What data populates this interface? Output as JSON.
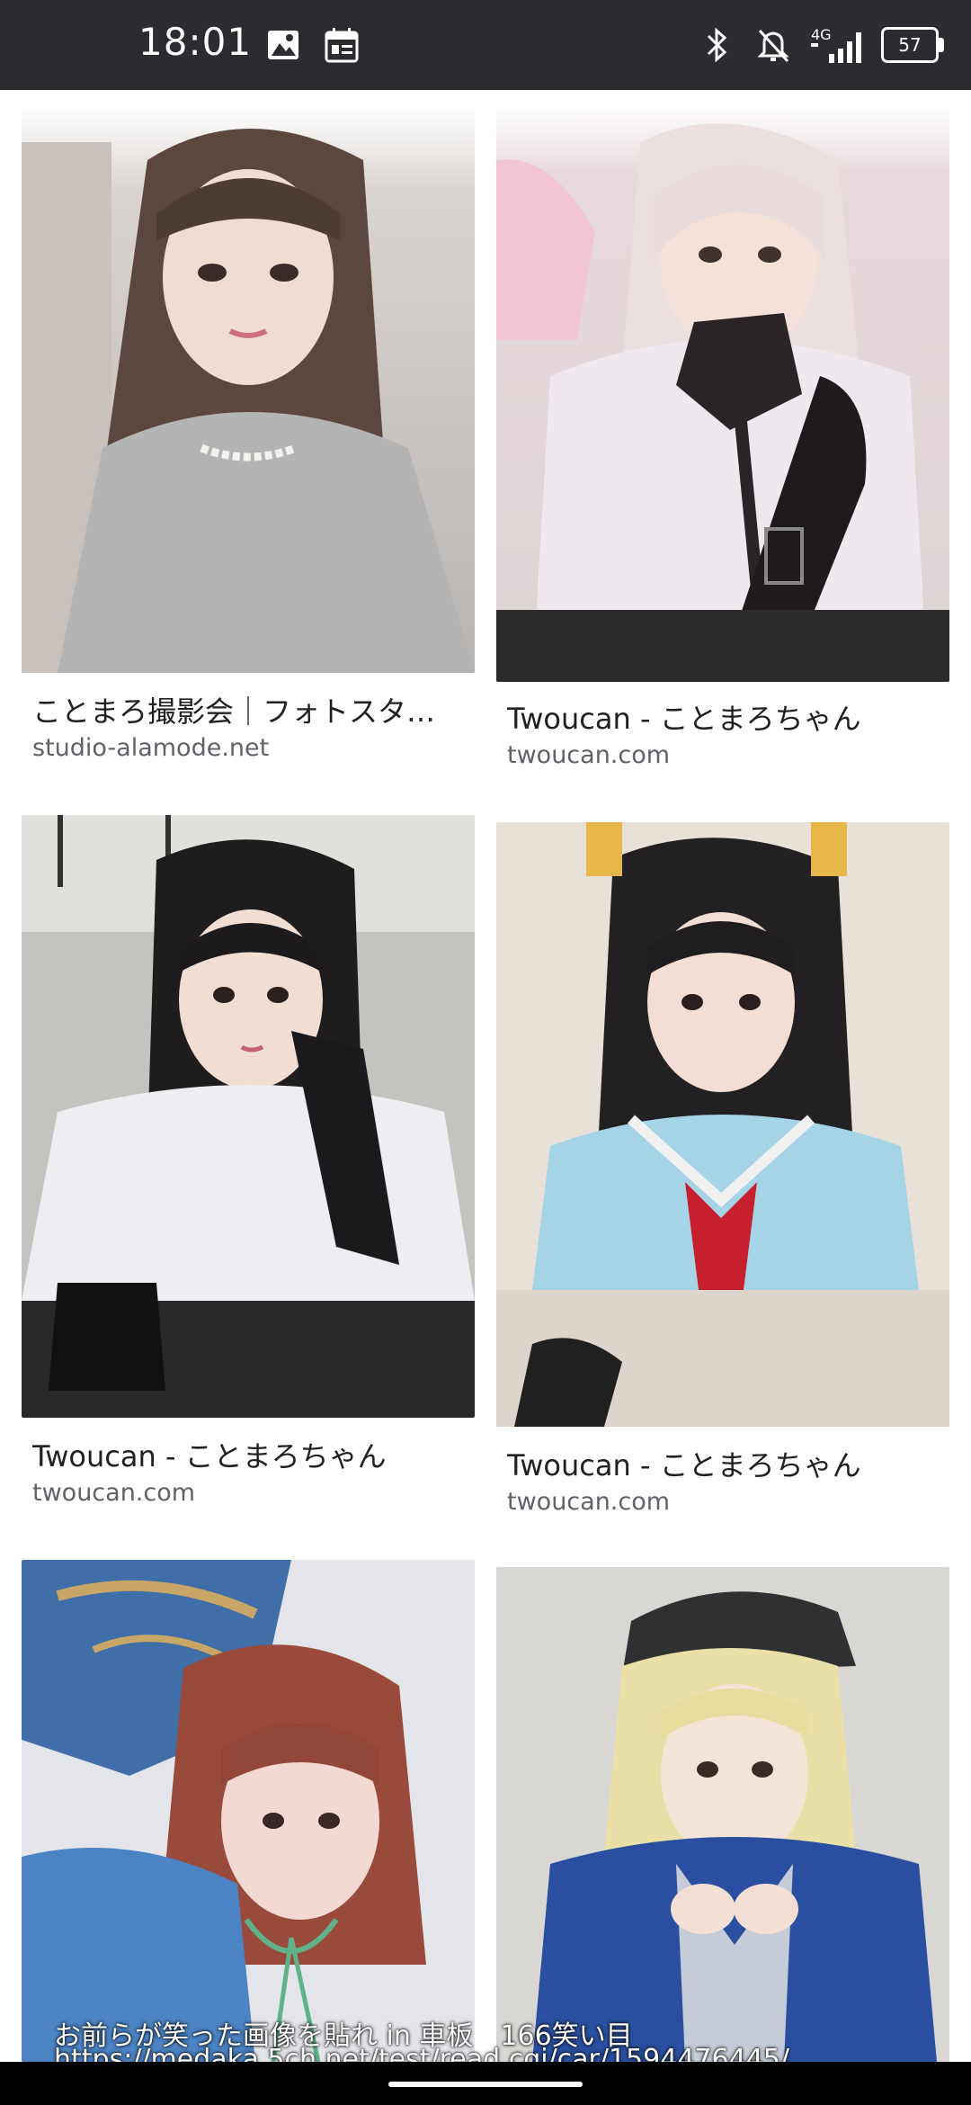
{
  "status_bar": {
    "time": "18:01",
    "battery": "57",
    "network": "4G",
    "icons": [
      "gallery-icon",
      "calendar-icon",
      "bluetooth-icon",
      "mute-icon",
      "signal-icon",
      "battery-icon"
    ]
  },
  "results": [
    {
      "title": "ことまろ撮影会｜フォトスタ…",
      "domain": "studio-alamode.net",
      "image": "cosplay photo: long dark hair, grey sweater with pearl necklace"
    },
    {
      "title": "Twoucan - ことまろちゃん",
      "domain": "twoucan.com",
      "image": "cosplay photo: pale pink hair, white outfit with black scarf and glove"
    },
    {
      "title": "Twoucan - ことまろちゃん",
      "domain": "twoucan.com",
      "image": "cosplay photo: black hair, white dress with black lace"
    },
    {
      "title": "Twoucan - ことまろちゃん",
      "domain": "twoucan.com",
      "image": "cosplay photo: black hair with yellow ribbon, light blue sailor uniform"
    },
    {
      "title": "",
      "domain": "",
      "image": "cosplay photo: auburn hair, blue ornate armor headpiece"
    },
    {
      "title": "",
      "domain": "",
      "image": "cosplay photo: blonde hair, black cap, blue jacket"
    }
  ],
  "overlay": {
    "line1": "お前らが笑った画像を貼れ in 車板　166笑い目",
    "line2": "https://medaka.5ch.net/test/read.cgi/car/1594476445/"
  },
  "colors": {
    "status_bar_bg": "#2b2c2f",
    "title_text": "#202124",
    "domain_text": "#5f6368"
  }
}
